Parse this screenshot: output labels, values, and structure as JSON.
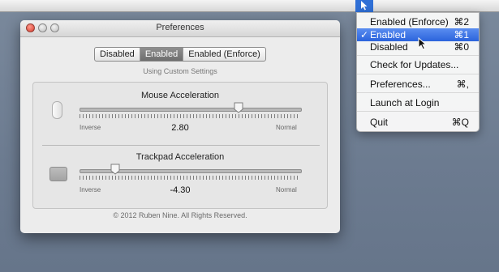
{
  "window": {
    "title": "Preferences"
  },
  "mode_control": {
    "options": [
      "Disabled",
      "Enabled",
      "Enabled (Enforce)"
    ],
    "selected": "Enabled"
  },
  "status_text": "Using Custom Settings",
  "mouse": {
    "title": "Mouse Acceleration",
    "value": "2.80",
    "min_label": "Inverse",
    "max_label": "Normal",
    "slider_level": 0.72
  },
  "trackpad": {
    "title": "Trackpad Acceleration",
    "value": "-4.30",
    "min_label": "Inverse",
    "max_label": "Normal",
    "slider_level": 0.16
  },
  "footer": "© 2012 Ruben Nine. All Rights Reserved.",
  "status_menu": {
    "items": [
      {
        "label": "Enabled (Enforce)",
        "shortcut": "⌘2",
        "checked": false
      },
      {
        "label": "Enabled",
        "shortcut": "⌘1",
        "checked": true
      },
      {
        "label": "Disabled",
        "shortcut": "⌘0",
        "checked": false
      },
      {
        "label": "Check for Updates...",
        "shortcut": ""
      },
      {
        "label": "Preferences...",
        "shortcut": "⌘,"
      },
      {
        "label": "Launch at Login",
        "shortcut": ""
      },
      {
        "label": "Quit",
        "shortcut": "⌘Q"
      }
    ]
  },
  "colors": {
    "accent": "#2a63dc",
    "desktop": "#6f7e92"
  }
}
